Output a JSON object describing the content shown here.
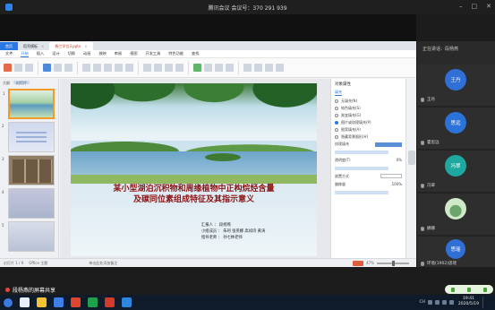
{
  "meeting": {
    "title": "腾讯会议 会议号：370 291 939"
  },
  "wps": {
    "tabs": [
      {
        "label": "首页"
      },
      {
        "label": "稻壳模板"
      },
      {
        "label": "杨兰学位3.pptx"
      }
    ],
    "menu": [
      "文件",
      "开始",
      "插入",
      "设计",
      "切换",
      "动画",
      "放映",
      "审阅",
      "视图",
      "开发工具",
      "特色功能",
      "查找"
    ],
    "thumbs_header": {
      "tab1": "大纲",
      "tab2": "幻灯片"
    },
    "thumb_numbers": [
      "1",
      "2",
      "3",
      "4",
      "5"
    ],
    "slide": {
      "title_line1": "某小型湖泊沉积物和周缘植物中正构烷烃含量",
      "title_line2": "及碳同位素组成特征及其指示意义",
      "credits": [
        "汇报人 ： 段杨燕",
        "小组成员 ： 朱珂  张英娜  高如诗  黄涛",
        "指导老师 ： 孙七林老师"
      ]
    },
    "props": {
      "title": "对象属性",
      "tab": "填充",
      "options": [
        "无填充(N)",
        "纯色填充(S)",
        "渐变填充(G)",
        "图片或纹理填充(P)",
        "图案填充(A)",
        "隐藏背景图形(H)"
      ],
      "labels": [
        "纹理填充",
        "透明度(T)",
        "放置方式",
        "偏移量"
      ],
      "values": [
        "0%",
        "100%"
      ]
    },
    "status": {
      "page": "幻灯片 1 / 9",
      "theme": "Office 主题",
      "notes": "单击此处添加备注",
      "zoom": "47%"
    }
  },
  "participants": {
    "speaking": "正在讲话：段杨燕",
    "list": [
      {
        "avatar_text": "王丹",
        "name": "王丹",
        "color": "#2f6fd6",
        "kind": "text"
      },
      {
        "avatar_text": "思远",
        "name": "霍思远",
        "color": "#2b73d8",
        "kind": "text"
      },
      {
        "avatar_text": "冯翠",
        "name": "冯翠",
        "color": "#1ea8a0",
        "kind": "text"
      },
      {
        "avatar_text": "",
        "name": "娜娜",
        "color": "#6aa66b",
        "kind": "plant"
      },
      {
        "avatar_text": "思瑶",
        "name": "环境(1902)思瑶",
        "color": "#2f6fd6",
        "kind": "text"
      }
    ]
  },
  "share_label": "段杨燕的屏幕共享",
  "clock": {
    "time": "19:41",
    "date": "2020/5/19"
  },
  "tray_lang": "CH"
}
